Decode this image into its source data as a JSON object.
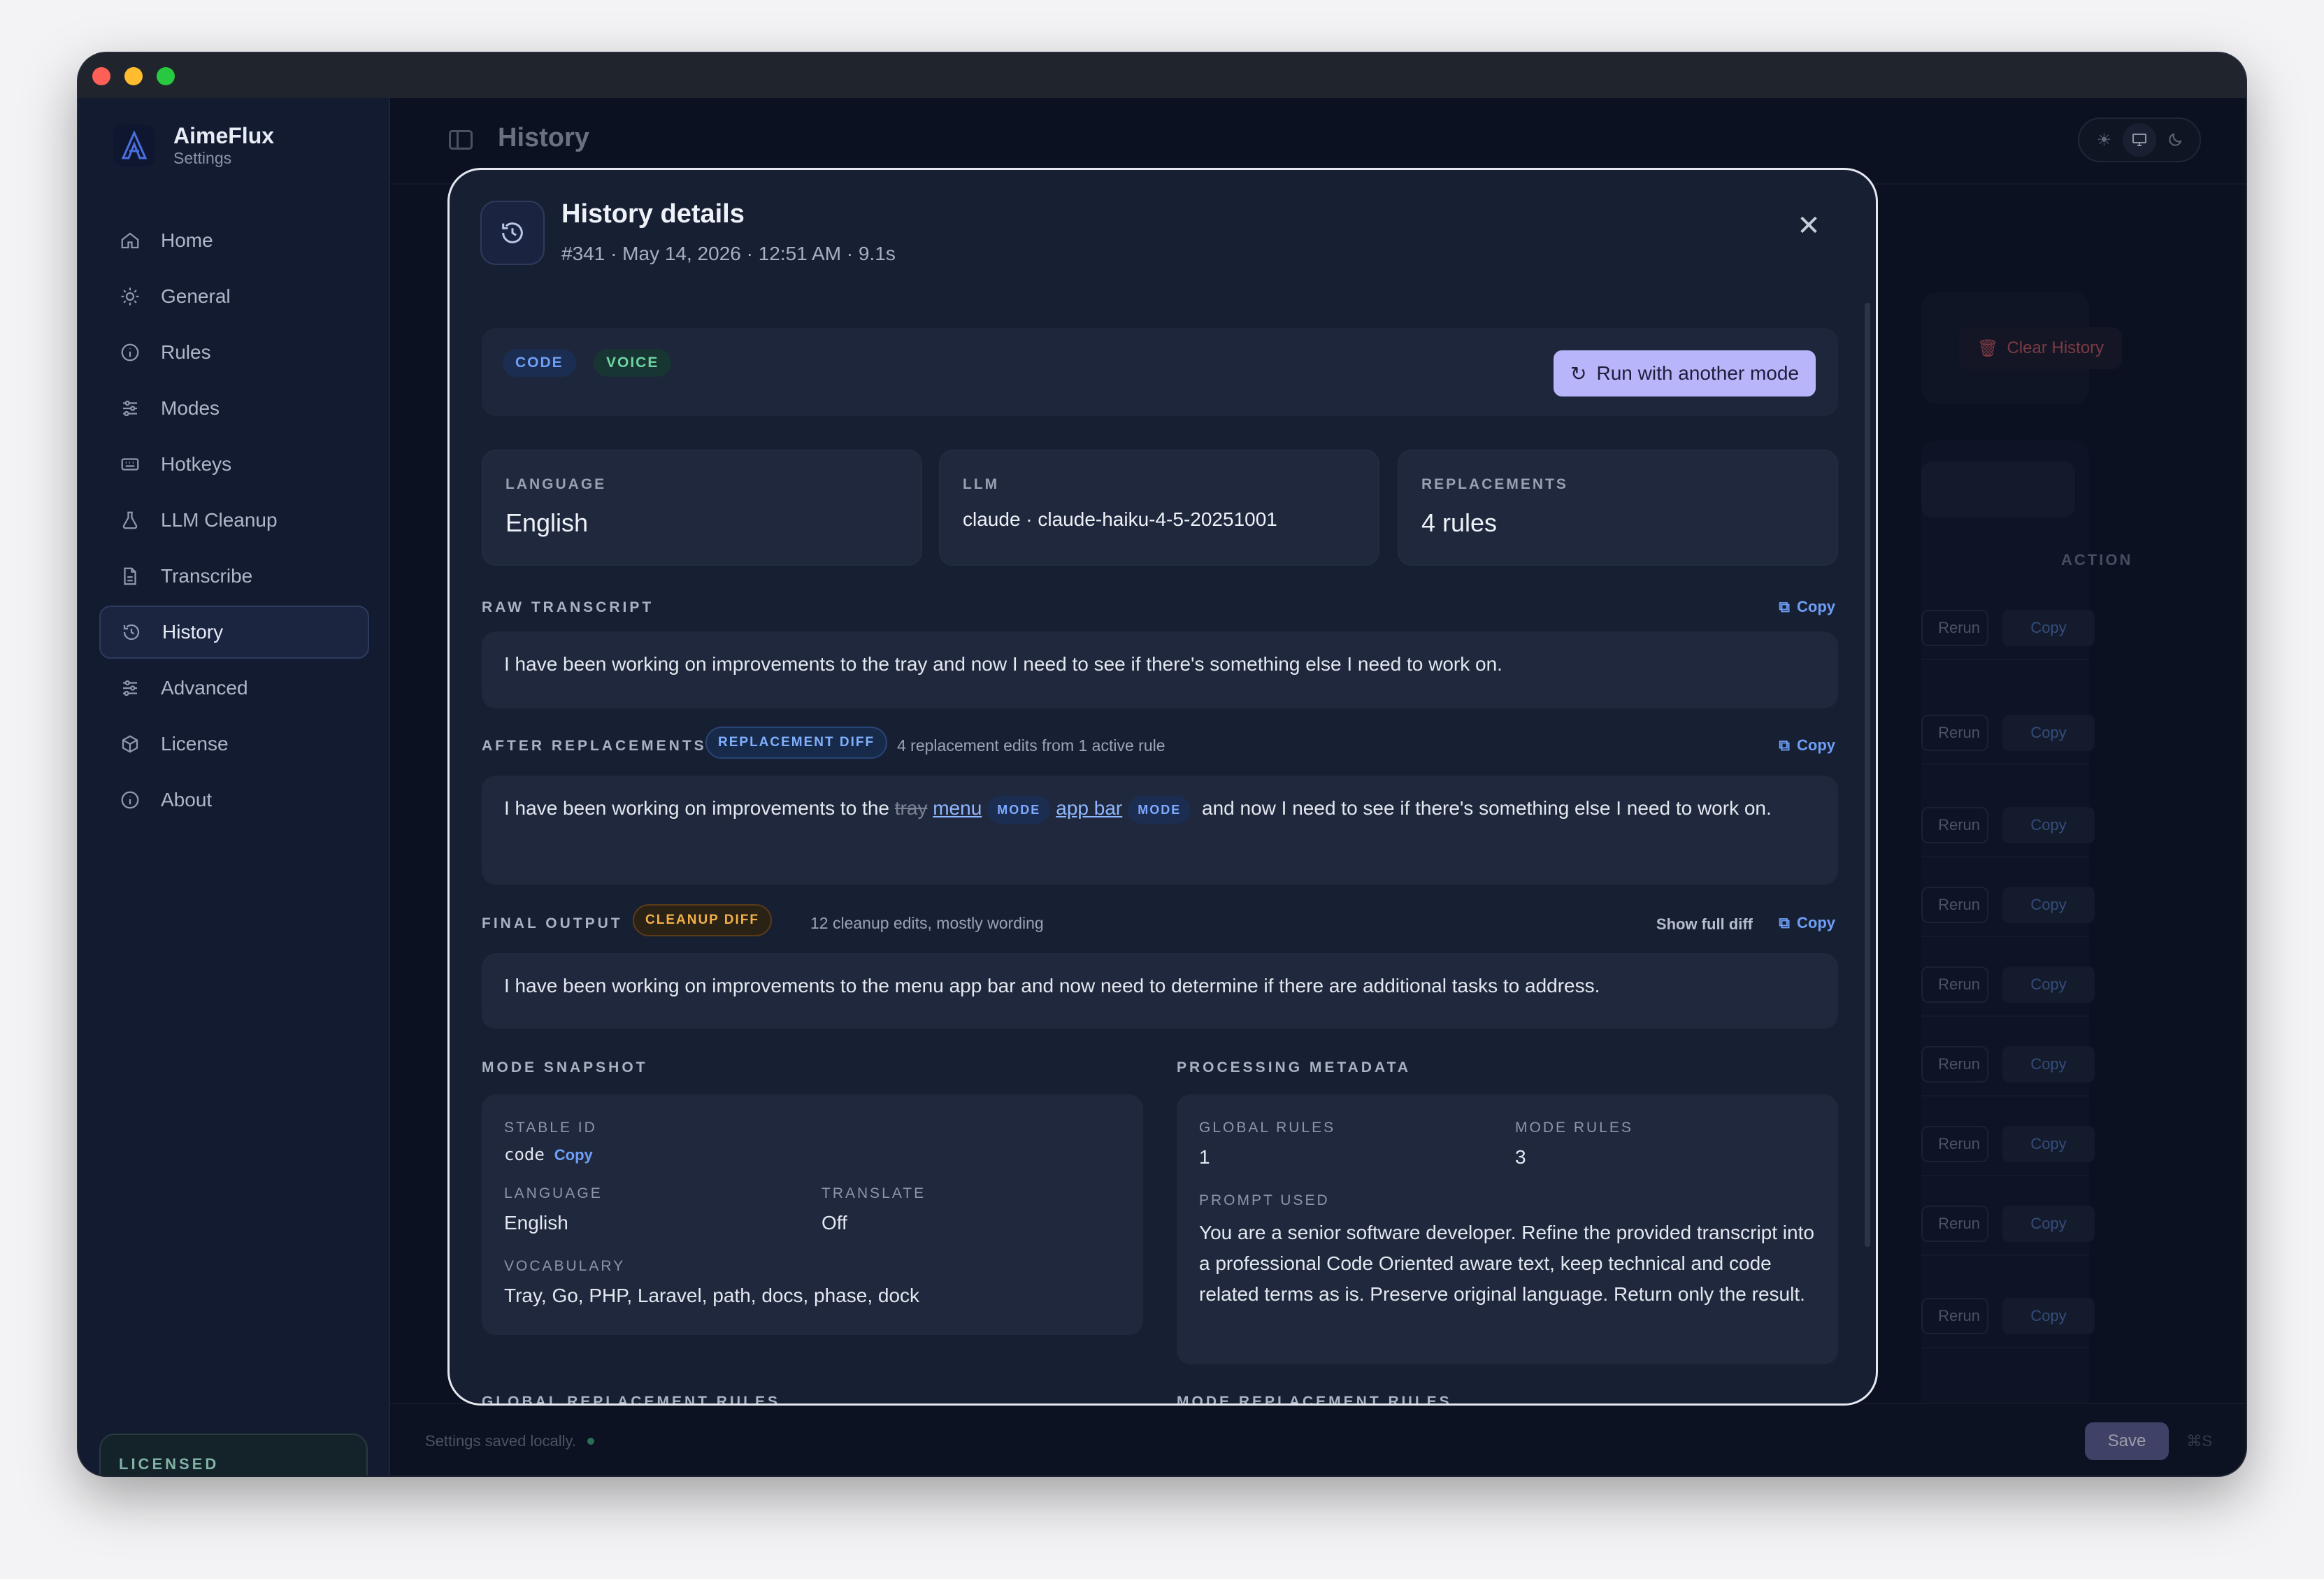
{
  "app": {
    "name": "AimeFlux",
    "subtitle": "Settings"
  },
  "sidebar": {
    "items": [
      {
        "label": "Home",
        "icon": "home-icon"
      },
      {
        "label": "General",
        "icon": "sun-icon"
      },
      {
        "label": "Rules",
        "icon": "info-icon"
      },
      {
        "label": "Modes",
        "icon": "sliders-icon"
      },
      {
        "label": "Hotkeys",
        "icon": "keyboard-icon"
      },
      {
        "label": "LLM Cleanup",
        "icon": "flask-icon"
      },
      {
        "label": "Transcribe",
        "icon": "file-icon"
      },
      {
        "label": "History",
        "icon": "history-icon",
        "active": true
      },
      {
        "label": "Advanced",
        "icon": "sliders-icon"
      },
      {
        "label": "License",
        "icon": "cube-icon"
      },
      {
        "label": "About",
        "icon": "info-icon"
      }
    ],
    "license_badge": "LICENSED"
  },
  "header": {
    "title": "History"
  },
  "background": {
    "clear_history": "Clear History",
    "action_header": "ACTION",
    "rerun_label": "Rerun",
    "copy_label": "Copy"
  },
  "footer": {
    "status": "Settings saved locally.",
    "save_label": "Save",
    "save_shortcut": "⌘S"
  },
  "modal": {
    "title": "History details",
    "subtitle": "#341 · May 14, 2026 · 12:51 AM · 9.1s",
    "tags": [
      "CODE",
      "VOICE"
    ],
    "run_button": "Run with another mode",
    "stats": {
      "language_label": "LANGUAGE",
      "language_value": "English",
      "llm_label": "LLM",
      "llm_value": "claude · claude-haiku-4-5-20251001",
      "replacements_label": "REPLACEMENTS",
      "replacements_value": "4 rules"
    },
    "raw": {
      "label": "RAW TRANSCRIPT",
      "copy": "Copy",
      "text": "I have been working on improvements to the tray and now I need to see if there's something else I need to work on."
    },
    "after": {
      "label": "AFTER REPLACEMENTS",
      "pill": "REPLACEMENT DIFF",
      "note": "4 replacement edits from 1 active rule",
      "copy": "Copy",
      "prefix": "I have been working on improvements to the",
      "removed": "tray",
      "ins1": "menu",
      "tag": "MODE",
      "ins2": "app bar",
      "suffix": "and now I need to see if there's something else I need to work on."
    },
    "final": {
      "label": "FINAL OUTPUT",
      "pill": "CLEANUP DIFF",
      "note": "12 cleanup edits, mostly wording",
      "show_diff": "Show full diff",
      "copy": "Copy",
      "text": "I have been working on improvements to the menu app bar and now need to determine if there are additional tasks to address."
    },
    "snapshot": {
      "label": "MODE SNAPSHOT",
      "stable_id_label": "STABLE ID",
      "stable_id_value": "code",
      "copy": "Copy",
      "language_label": "LANGUAGE",
      "language_value": "English",
      "translate_label": "TRANSLATE",
      "translate_value": "Off",
      "vocab_label": "VOCABULARY",
      "vocab_value": "Tray, Go, PHP, Laravel, path, docs, phase, dock"
    },
    "metadata": {
      "label": "PROCESSING METADATA",
      "global_rules_label": "GLOBAL RULES",
      "global_rules_value": "1",
      "mode_rules_label": "MODE RULES",
      "mode_rules_value": "3",
      "prompt_label": "PROMPT USED",
      "prompt_value": "You are a senior software developer. Refine the provided transcript into a professional Code Oriented aware text, keep technical and code related terms as is. Preserve original language. Return only the result."
    },
    "global_rules_label": "GLOBAL REPLACEMENT RULES",
    "mode_rules_label": "MODE REPLACEMENT RULES"
  }
}
